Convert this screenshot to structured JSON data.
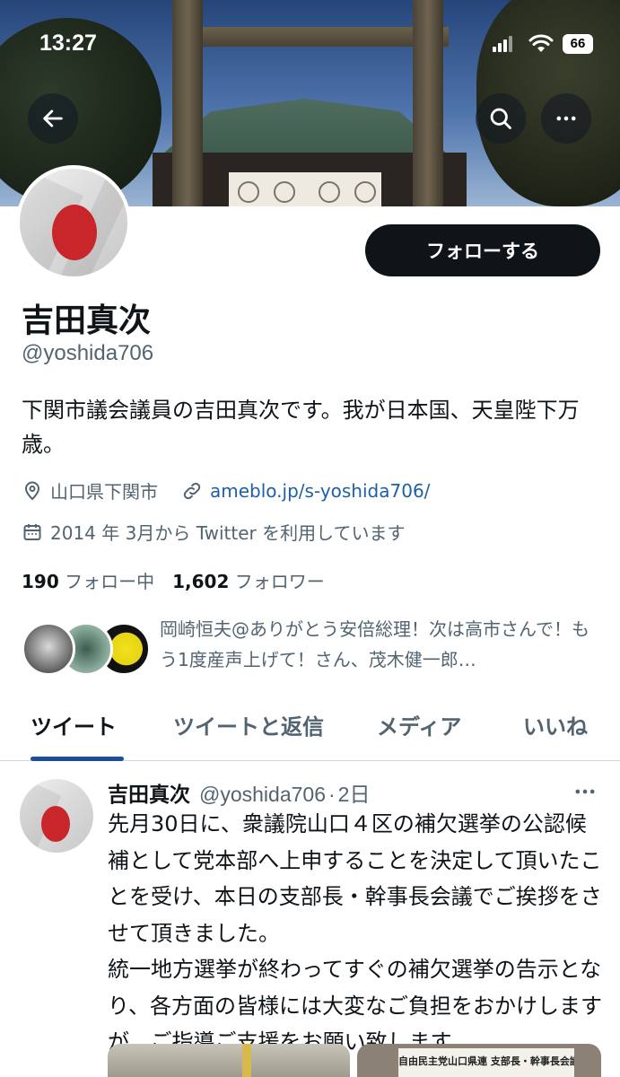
{
  "status_bar": {
    "time": "13:27",
    "battery": "66"
  },
  "header": {
    "back_icon": "arrow-left-icon",
    "search_icon": "search-icon",
    "more_icon": "more-horizontal-icon"
  },
  "profile": {
    "follow_label": "フォローする",
    "name": "吉田真次",
    "handle": "@yoshida706",
    "bio": "下関市議会議員の吉田真次です。我が日本国、天皇陛下万歳。",
    "location": "山口県下関市",
    "website": "ameblo.jp/s-yoshida706/",
    "joined": "2014 年 3月から Twitter を利用しています",
    "following_count": "190",
    "following_label": "フォロー中",
    "followers_count": "1,602",
    "followers_label": "フォロワー",
    "followed_by": "岡崎恒夫@ありがとう安倍総理！次は高市さんで！もう1度産声上げて！さん、茂木健一郎…"
  },
  "tabs": [
    {
      "label": "ツイート",
      "active": true
    },
    {
      "label": "ツイートと返信",
      "active": false
    },
    {
      "label": "メディア",
      "active": false
    },
    {
      "label": "いいね",
      "active": false
    }
  ],
  "tweet": {
    "name": "吉田真次",
    "handle": "@yoshida706",
    "separator": "·",
    "time": "2日",
    "text": "先月30日に、衆議院山口４区の補欠選挙の公認候補として党本部へ上申することを決定して頂いたことを受け、本日の支部長・幹事長会議でご挨拶をさせて頂きました。\n統一地方選挙が終わってすぐの補欠選挙の告示となり、各方面の皆様には大変なご負担をおかけしますが、ご指導ご支援をお願い致します。",
    "media_banner_text": "自由民主党山口県連 支部長・幹事長会議"
  },
  "colors": {
    "accent": "#1d4e9e",
    "link": "#1d5fa8",
    "follow_button": "#0f1419",
    "secondary_text": "#536471",
    "flag_red": "#c9262c"
  }
}
